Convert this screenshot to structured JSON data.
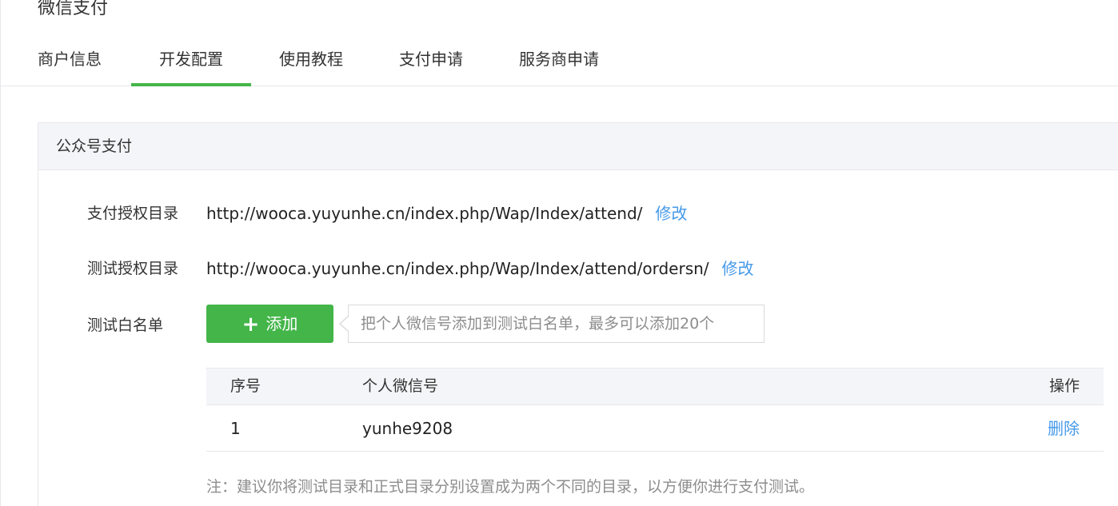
{
  "page": {
    "title": "微信支付"
  },
  "tabs": [
    {
      "label": "商户信息",
      "active": false
    },
    {
      "label": "开发配置",
      "active": true
    },
    {
      "label": "使用教程",
      "active": false
    },
    {
      "label": "支付申请",
      "active": false
    },
    {
      "label": "服务商申请",
      "active": false
    }
  ],
  "panel": {
    "title": "公众号支付",
    "pay_dir": {
      "label": "支付授权目录",
      "value": "http://wooca.yuyunhe.cn/index.php/Wap/Index/attend/",
      "action": "修改"
    },
    "test_dir": {
      "label": "测试授权目录",
      "value": "http://wooca.yuyunhe.cn/index.php/Wap/Index/attend/ordersn/",
      "action": "修改"
    },
    "whitelist": {
      "label": "测试白名单",
      "add_button": "添加",
      "add_icon": "plus-icon",
      "tip": "把个人微信号添加到测试白名单，最多可以添加20个",
      "columns": {
        "seq": "序号",
        "wechat_id": "个人微信号",
        "action": "操作"
      },
      "rows": [
        {
          "seq": "1",
          "wechat_id": "yunhe9208",
          "action": "删除"
        }
      ]
    },
    "note": "注：建议你将测试目录和正式目录分别设置成为两个不同的目录，以方便你进行支付测试。"
  },
  "colors": {
    "accent_green": "#44b549",
    "link_blue": "#459ae9",
    "header_bg": "#f4f5f9",
    "border": "#e7e7eb"
  }
}
